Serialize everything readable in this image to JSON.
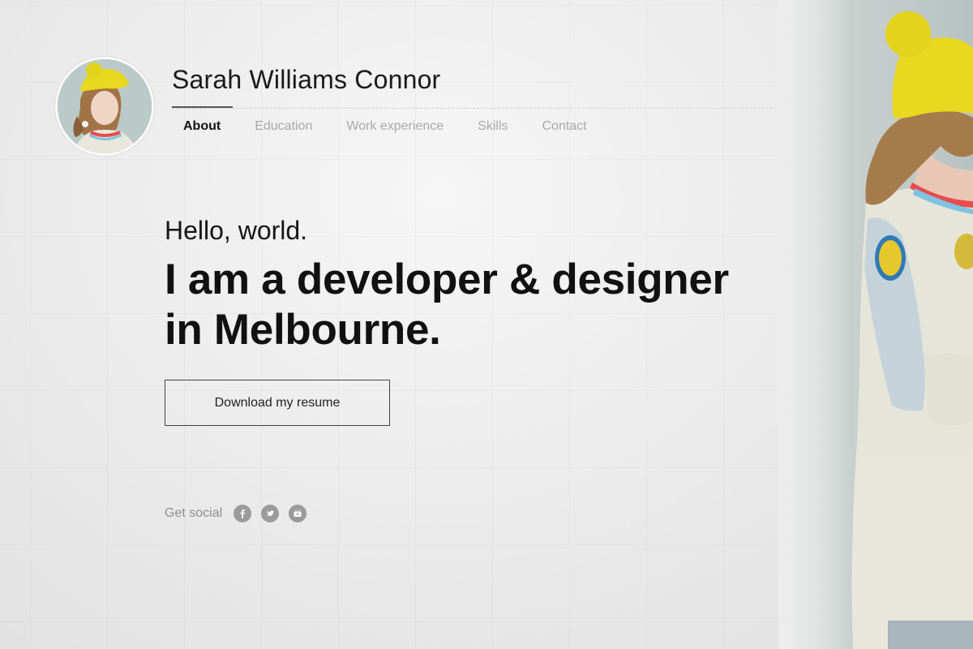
{
  "header": {
    "name": "Sarah Williams Connor",
    "avatar_icon": "profile-photo"
  },
  "nav": {
    "items": [
      {
        "label": "About",
        "active": true
      },
      {
        "label": "Education",
        "active": false
      },
      {
        "label": "Work experience",
        "active": false
      },
      {
        "label": "Skills",
        "active": false
      },
      {
        "label": "Contact",
        "active": false
      }
    ]
  },
  "hero": {
    "greeting": "Hello, world.",
    "headline_line1": "I am a developer & designer",
    "headline_line2": "in Melbourne.",
    "button_label": "Download my resume"
  },
  "social": {
    "label": "Get social",
    "icons": [
      "facebook-icon",
      "twitter-icon",
      "youtube-icon"
    ]
  },
  "colors": {
    "accent_hat": "#e8d81f",
    "text_primary": "#111111",
    "text_muted": "#a9a9a9",
    "social_icon_bg": "#9b9b9b"
  }
}
